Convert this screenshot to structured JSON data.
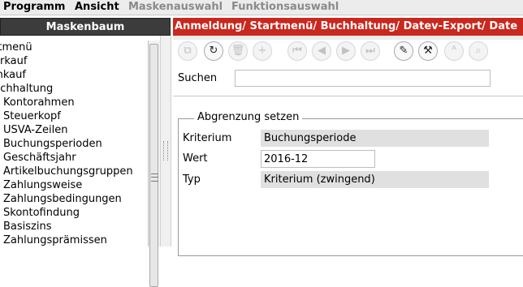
{
  "menu": {
    "items": [
      {
        "label": "Programm",
        "enabled": true
      },
      {
        "label": "Ansicht",
        "enabled": true
      },
      {
        "label": "Maskenauswahl",
        "enabled": false
      },
      {
        "label": "Funktionsauswahl",
        "enabled": false
      }
    ]
  },
  "left_panel": {
    "title": "Maskenbaum",
    "tree": [
      {
        "label": "rtmenü",
        "level": 0
      },
      {
        "label": "erkauf",
        "level": 0
      },
      {
        "label": "inkauf",
        "level": 0
      },
      {
        "label": "uchhaltung",
        "level": 0
      },
      {
        "label": "Kontorahmen",
        "level": 1
      },
      {
        "label": "Steuerkopf",
        "level": 1
      },
      {
        "label": "USVA-Zeilen",
        "level": 1
      },
      {
        "label": "Buchungsperioden",
        "level": 1
      },
      {
        "label": "Geschäftsjahr",
        "level": 1
      },
      {
        "label": "Artikelbuchungsgruppen",
        "level": 1
      },
      {
        "label": "Zahlungsweise",
        "level": 1
      },
      {
        "label": "Zahlungsbedingungen",
        "level": 1
      },
      {
        "label": "Skontofindung",
        "level": 1
      },
      {
        "label": "Basiszins",
        "level": 1
      },
      {
        "label": "Zahlungsprämissen",
        "level": 1
      }
    ]
  },
  "right_panel": {
    "breadcrumb": "Anmeldung/ Startmenü/ Buchhaltung/ Datev-Export/ Date",
    "toolbar": [
      {
        "name": "new-window-icon",
        "glyph": "⧉",
        "enabled": false
      },
      {
        "name": "refresh-icon",
        "glyph": "↻",
        "enabled": true
      },
      {
        "name": "delete-icon",
        "glyph": "🗑",
        "enabled": false
      },
      {
        "name": "add-icon",
        "glyph": "+",
        "enabled": false
      },
      {
        "name": "first-record-icon",
        "glyph": "⏮",
        "enabled": false
      },
      {
        "name": "previous-record-icon",
        "glyph": "◀",
        "enabled": false
      },
      {
        "name": "next-record-icon",
        "glyph": "▶",
        "enabled": false
      },
      {
        "name": "last-record-icon",
        "glyph": "⏭",
        "enabled": false
      },
      {
        "name": "edit-icon",
        "glyph": "✎",
        "enabled": true
      },
      {
        "name": "tools-icon",
        "glyph": "⚒",
        "enabled": true
      },
      {
        "name": "search-replace-icon",
        "glyph": "ᴬ",
        "enabled": false
      },
      {
        "name": "search-record-icon",
        "glyph": "⌕",
        "enabled": false
      }
    ],
    "search": {
      "label": "Suchen",
      "value": ""
    },
    "group": {
      "legend": "Abgrenzung setzen",
      "kriterium": {
        "label": "Kriterium",
        "value": "Buchungsperiode"
      },
      "wert": {
        "label": "Wert",
        "value": "2016-12"
      },
      "typ": {
        "label": "Typ",
        "value": "Kriterium (zwingend)"
      }
    }
  },
  "colors": {
    "breadcrumb_bg": "#c8281e",
    "tree_header_bg": "#3c3c3c",
    "readonly_field_bg": "#e0e0e0"
  }
}
